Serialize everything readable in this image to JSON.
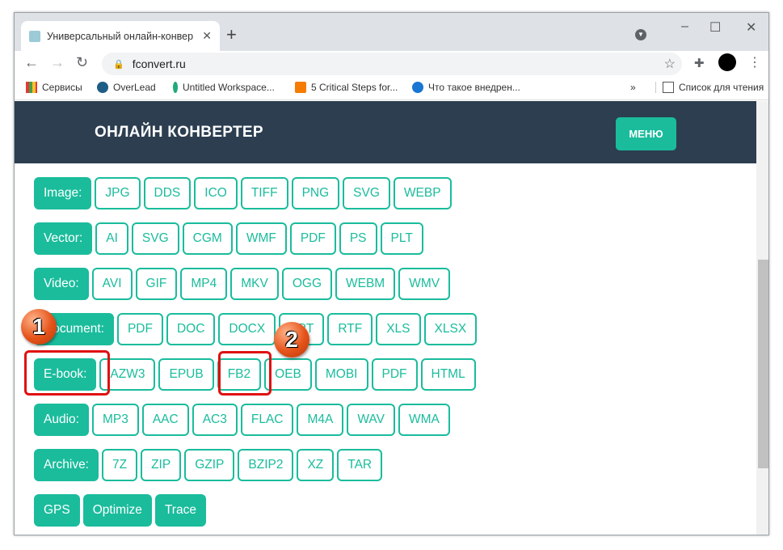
{
  "browser": {
    "tab_title": "Универсальный онлайн-конвер",
    "url": "fconvert.ru",
    "bookmarks": [
      "Сервисы",
      "OverLead",
      "Untitled Workspace...",
      "5 Critical Steps for...",
      "Что такое внедрен..."
    ],
    "overflow": "»",
    "reading_list": "Список для чтения"
  },
  "site": {
    "logo": "ОНЛАЙН КОНВЕРТЕР",
    "menu": "МЕНЮ",
    "accent": "#1abc9c",
    "header_bg": "#2c3e50",
    "rows": [
      {
        "label": "Image:",
        "formats": [
          "JPG",
          "DDS",
          "ICO",
          "TIFF",
          "PNG",
          "SVG",
          "WEBP"
        ]
      },
      {
        "label": "Vector:",
        "formats": [
          "AI",
          "SVG",
          "CGM",
          "WMF",
          "PDF",
          "PS",
          "PLT"
        ]
      },
      {
        "label": "Video:",
        "formats": [
          "AVI",
          "GIF",
          "MP4",
          "MKV",
          "OGG",
          "WEBM",
          "WMV"
        ]
      },
      {
        "label": "Document:",
        "formats": [
          "PDF",
          "DOC",
          "DOCX",
          "PPT",
          "RTF",
          "XLS",
          "XLSX"
        ]
      },
      {
        "label": "E-book:",
        "formats": [
          "AZW3",
          "EPUB",
          "FB2",
          "OEB",
          "MOBI",
          "PDF",
          "HTML"
        ]
      },
      {
        "label": "Audio:",
        "formats": [
          "MP3",
          "AAC",
          "AC3",
          "FLAC",
          "M4A",
          "WAV",
          "WMA"
        ]
      },
      {
        "label": "Archive:",
        "formats": [
          "7Z",
          "ZIP",
          "GZIP",
          "BZIP2",
          "XZ",
          "TAR"
        ]
      }
    ],
    "tools": [
      "GPS",
      "Optimize",
      "Trace"
    ]
  },
  "annotations": {
    "step1": "1",
    "step2": "2",
    "highlight_color": "#e01010"
  }
}
